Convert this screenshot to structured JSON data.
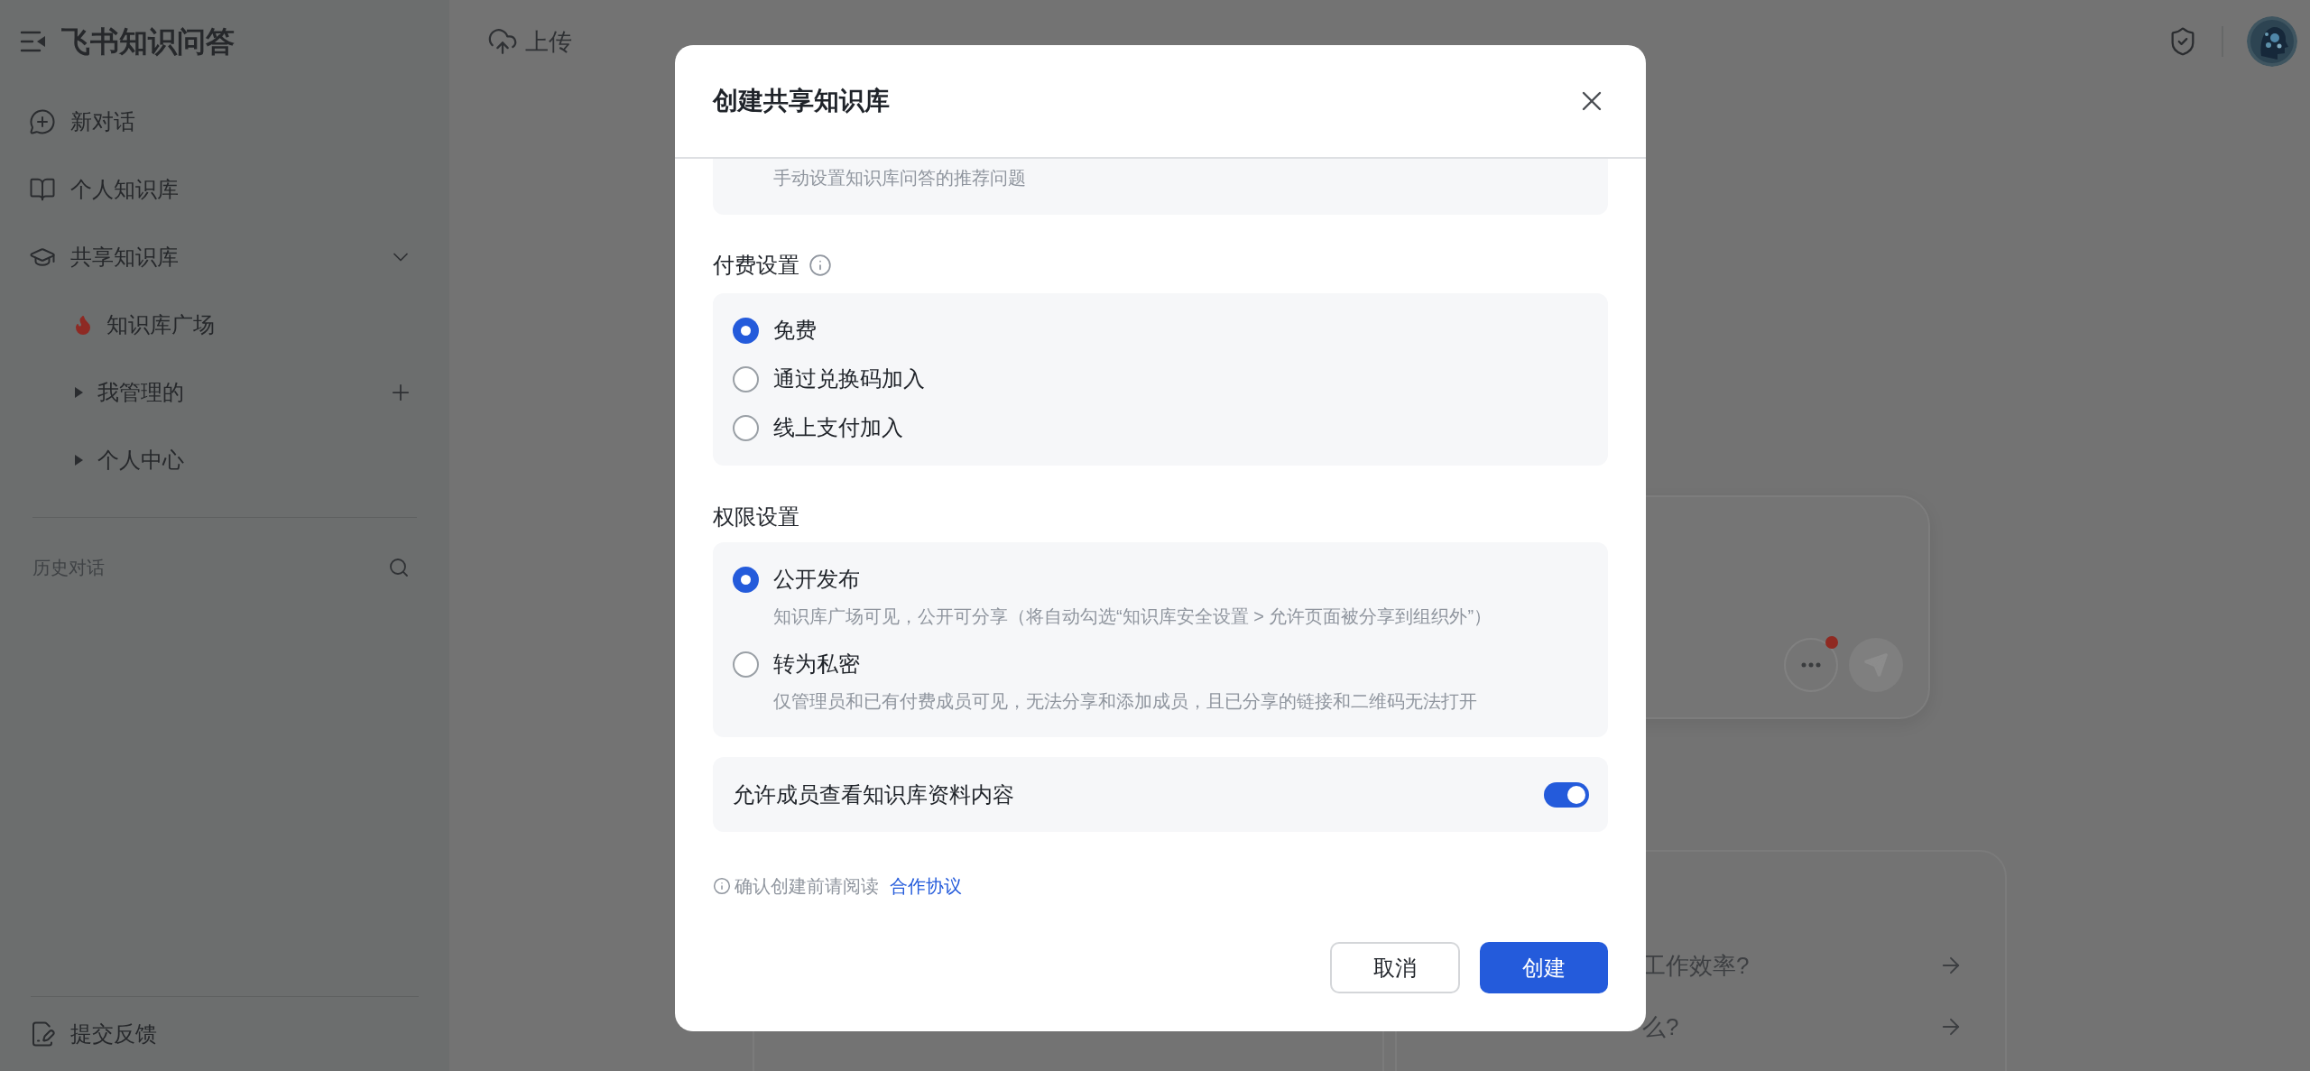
{
  "sidebar": {
    "title": "飞书知识问答",
    "items": [
      {
        "kind": "chat",
        "label": "新对话"
      },
      {
        "kind": "book",
        "label": "个人知识库"
      },
      {
        "kind": "cap",
        "label": "共享知识库",
        "expanded": true,
        "children": [
          {
            "kind": "hot",
            "label": "知识库广场"
          },
          {
            "kind": "folder",
            "label": "我管理的",
            "expanded": false,
            "addable": true
          },
          {
            "kind": "folder",
            "label": "个人中心",
            "expanded": false,
            "addable": false
          }
        ]
      }
    ],
    "history": {
      "label": "历史对话"
    },
    "footer": {
      "label": "提交反馈"
    }
  },
  "topbar": {
    "upload": "上传"
  },
  "composer": {
    "more_has_badge": true
  },
  "suggestions": [
    {
      "text": "工作效率?"
    },
    {
      "text": "么?"
    }
  ],
  "dialog": {
    "title": "创建共享知识库",
    "cut_section": {
      "description": "手动设置知识库问答的推荐问题"
    },
    "payment": {
      "title": "付费设置",
      "options": [
        {
          "label": "免费",
          "selected": true
        },
        {
          "label": "通过兑换码加入",
          "selected": false
        },
        {
          "label": "线上支付加入",
          "selected": false
        }
      ]
    },
    "permission": {
      "title": "权限设置",
      "options": [
        {
          "label": "公开发布",
          "description": "知识库广场可见，公开可分享（将自动勾选“知识库安全设置 > 允许页面被分享到组织外”）",
          "selected": true
        },
        {
          "label": "转为私密",
          "description": "仅管理员和已有付费成员可见，无法分享和添加成员，且已分享的链接和二维码无法打开",
          "selected": false
        }
      ]
    },
    "allow_view": {
      "label": "允许成员查看知识库资料内容",
      "on": true
    },
    "agreement": {
      "text": "确认创建前请阅读",
      "link": "合作协议"
    },
    "buttons": [
      {
        "kind": "secondary",
        "label": "取消"
      },
      {
        "kind": "primary",
        "label": "创建"
      }
    ]
  }
}
